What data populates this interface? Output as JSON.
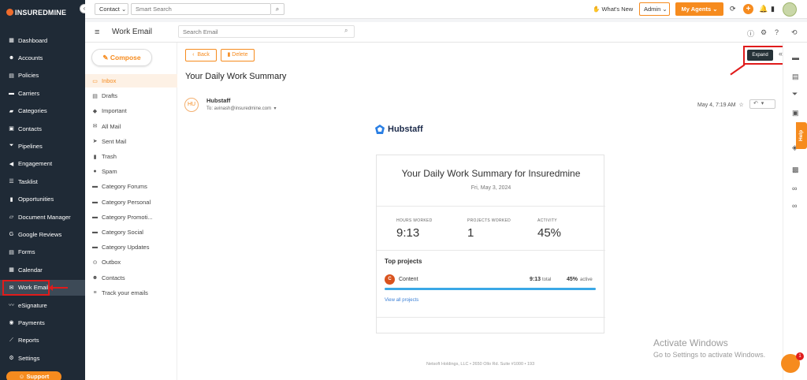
{
  "brand": {
    "name": "INSUREDMINE",
    "accent": "#f68b1e",
    "sidebar_bg": "#1f2a36",
    "highlight": "#e01b1b"
  },
  "sidebar": {
    "items": [
      {
        "label": "Dashboard",
        "icon": "dashboard-icon"
      },
      {
        "label": "Accounts",
        "icon": "users-icon"
      },
      {
        "label": "Policies",
        "icon": "document-icon"
      },
      {
        "label": "Carriers",
        "icon": "truck-icon"
      },
      {
        "label": "Categories",
        "icon": "folder-icon"
      },
      {
        "label": "Contacts",
        "icon": "contact-card-icon"
      },
      {
        "label": "Pipelines",
        "icon": "funnel-icon"
      },
      {
        "label": "Engagement",
        "icon": "megaphone-icon"
      },
      {
        "label": "Tasklist",
        "icon": "checklist-icon"
      },
      {
        "label": "Opportunities",
        "icon": "bar-chart-icon"
      },
      {
        "label": "Document Manager",
        "icon": "folder-open-icon"
      },
      {
        "label": "Google Reviews",
        "icon": "google-icon"
      },
      {
        "label": "Forms",
        "icon": "form-icon"
      },
      {
        "label": "Calendar",
        "icon": "calendar-icon"
      },
      {
        "label": "Work Email",
        "icon": "mail-icon"
      },
      {
        "label": "eSignature",
        "icon": "signature-icon"
      },
      {
        "label": "Payments",
        "icon": "payment-icon"
      },
      {
        "label": "Reports",
        "icon": "line-chart-icon"
      },
      {
        "label": "Settings",
        "icon": "gear-icon"
      }
    ],
    "support_label": "Support"
  },
  "topbar": {
    "contact_select": "Contact",
    "search_placeholder": "Smart Search",
    "whats_new": "What's New",
    "role_select": "Admin",
    "agents_label": "My Agents"
  },
  "header": {
    "title": "Work Email",
    "search_placeholder": "Search Email"
  },
  "compose_label": "Compose",
  "folders": [
    {
      "label": "Inbox",
      "icon": "inbox-icon"
    },
    {
      "label": "Drafts",
      "icon": "draft-icon"
    },
    {
      "label": "Important",
      "icon": "tag-icon"
    },
    {
      "label": "All Mail",
      "icon": "all-mail-icon"
    },
    {
      "label": "Sent Mail",
      "icon": "send-icon"
    },
    {
      "label": "Trash",
      "icon": "trash-icon"
    },
    {
      "label": "Spam",
      "icon": "spam-icon"
    },
    {
      "label": "Category Forums",
      "icon": "folder-icon"
    },
    {
      "label": "Category Personal",
      "icon": "folder-icon"
    },
    {
      "label": "Category Promoti...",
      "icon": "folder-icon"
    },
    {
      "label": "Category Social",
      "icon": "folder-icon"
    },
    {
      "label": "Category Updates",
      "icon": "folder-icon"
    },
    {
      "label": "Outbox",
      "icon": "outbox-icon"
    },
    {
      "label": "Contacts",
      "icon": "contacts-icon"
    },
    {
      "label": "Track your emails",
      "icon": "track-icon"
    }
  ],
  "message": {
    "back_label": "Back",
    "delete_label": "Delete",
    "expand_tooltip": "Expand",
    "subject": "Your Daily Work Summary",
    "sender_initials": "HU",
    "sender_name": "Hubstaff",
    "to_line": "To: avinash@insuredmine.com",
    "date": "May 4, 7:19 AM"
  },
  "email_body": {
    "logo_text": "Hubstaff",
    "card_title": "Your Daily Work Summary for Insuredmine",
    "card_date": "Fri, May 3, 2024",
    "stats": [
      {
        "label": "HOURS WORKED",
        "value": "9:13"
      },
      {
        "label": "PROJECTS WORKED",
        "value": "1"
      },
      {
        "label": "ACTIVITY",
        "value": "45%"
      }
    ],
    "top_projects_label": "Top projects",
    "project": {
      "initial": "C",
      "name": "Content",
      "time": "9:13",
      "time_unit": "total",
      "activity": "45%",
      "activity_unit": "active",
      "progress": 1.0
    },
    "view_all_label": "View all projects",
    "footer": "Netsoft Holdings, LLC • 2650 Ollo Rd. Suite #1000 • 193"
  },
  "help_label": "Help",
  "watermark": {
    "line1": "Activate Windows",
    "line2": "Go to Settings to activate Windows."
  },
  "chat_badge": "1"
}
